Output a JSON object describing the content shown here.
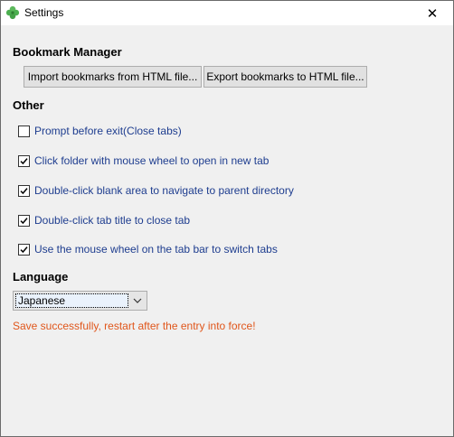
{
  "window": {
    "title": "Settings",
    "close_glyph": "✕",
    "icon": "clover-icon"
  },
  "bookmark": {
    "heading": "Bookmark Manager",
    "import_label": "Import bookmarks from HTML file...",
    "export_label": "Export bookmarks to HTML file..."
  },
  "other": {
    "heading": "Other",
    "options": [
      {
        "label": "Prompt before exit(Close tabs)",
        "checked": false
      },
      {
        "label": "Click folder with mouse wheel to open in new tab",
        "checked": true
      },
      {
        "label": "Double-click blank area to navigate to parent directory",
        "checked": true
      },
      {
        "label": "Double-click tab title to close tab",
        "checked": true
      },
      {
        "label": "Use the mouse wheel on the tab bar to switch tabs",
        "checked": true
      }
    ]
  },
  "language": {
    "heading": "Language",
    "selected": "Japanese"
  },
  "status": {
    "message": "Save successfully, restart after the entry into force!",
    "color": "#e0561b"
  },
  "colors": {
    "option_text": "#1e3d8f",
    "dialog_bg": "#f0f0f0",
    "icon_green": "#4caf50"
  }
}
